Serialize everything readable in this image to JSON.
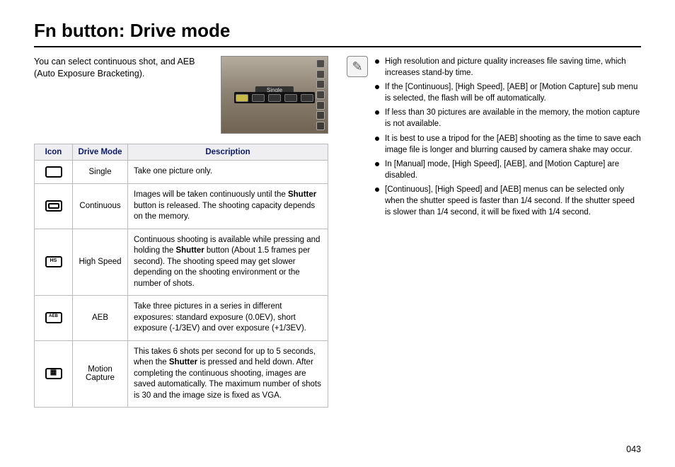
{
  "title": "Fn button: Drive mode",
  "intro": "You can select continuous shot, and AEB (Auto Exposure Bracketing).",
  "lcd_menu_label": "Single",
  "table": {
    "headers": {
      "icon": "Icon",
      "mode": "Drive Mode",
      "desc": "Description"
    },
    "rows": [
      {
        "mode": "Single",
        "desc_plain": "Take one picture only."
      },
      {
        "mode": "Continuous",
        "desc_pre": "Images will be taken continuously until the ",
        "desc_bold": "Shutter",
        "desc_post": " button is released.\nThe shooting capacity depends on the memory."
      },
      {
        "mode": "High Speed",
        "desc_pre": "Continuous shooting is available while pressing and holding the ",
        "desc_bold": "Shutter",
        "desc_post": " button (About 1.5 frames per second).\nThe shooting speed may get slower depending on the shooting environment or the number of shots."
      },
      {
        "mode": "AEB",
        "desc_plain": "Take three pictures in a series in different exposures: standard exposure (0.0EV), short exposure (-1/3EV) and over exposure (+1/3EV)."
      },
      {
        "mode": "Motion Capture",
        "desc_pre": "This takes 6 shots per second for up to 5 seconds, when the ",
        "desc_bold": "Shutter",
        "desc_post": " is pressed and held down. After completing the continuous shooting, images are saved automatically. The maximum number of shots is 30 and the image size is fixed as VGA."
      }
    ]
  },
  "notes": [
    "High resolution and picture quality increases file saving time, which increases stand-by time.",
    "If the [Continuous], [High Speed], [AEB] or [Motion Capture] sub menu is selected, the flash will be off automatically.",
    "If less than 30 pictures are available in the memory, the motion capture is not available.",
    "It is best to use a tripod for the [AEB] shooting as the time to save each image file is longer and blurring caused by camera shake may occur.",
    "In [Manual] mode, [High Speed], [AEB], and [Motion Capture] are disabled.",
    "[Continuous], [High Speed] and [AEB] menus can be selected only when the shutter speed is faster than 1/4 second. If the shutter speed is slower than 1/4 second, it will be fixed with 1/4 second."
  ],
  "page_number": "043",
  "note_icon_glyph": "✎"
}
